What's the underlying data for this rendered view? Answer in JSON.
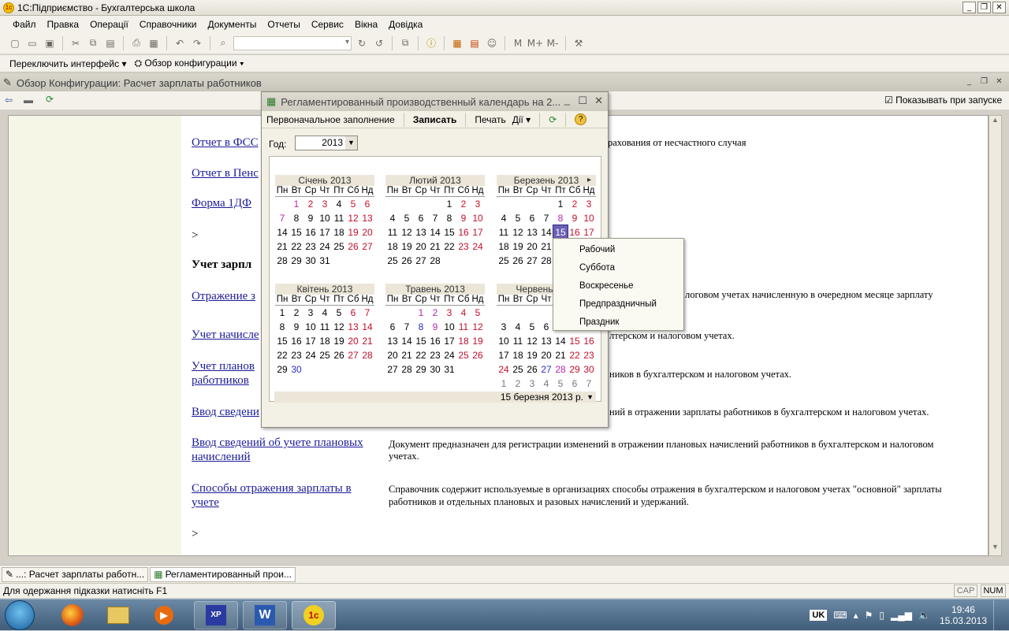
{
  "app": {
    "title": "1С:Підприємство - Бухгалтерська школа"
  },
  "menu": [
    "Файл",
    "Правка",
    "Операції",
    "Справочники",
    "Документы",
    "Отчеты",
    "Сервис",
    "Вікна",
    "Довідка"
  ],
  "toolbar2": {
    "switch_interface": "Переключить интерфейс",
    "overview": "Обзор конфигурации"
  },
  "overview": {
    "title": "Обзор Конфигурации: Расчет зарплаты работников",
    "show_on_start": "Показывать при запуске",
    "items": [
      {
        "link": "Отчет в ФСС",
        "desc": "рахования от несчастного случая"
      },
      {
        "link": "Отчет в Пенс",
        "desc": ""
      },
      {
        "link": "Форма 1ДФ",
        "desc": ""
      },
      {
        "link": ">",
        "desc": ""
      },
      {
        "link": "Учет зарпл",
        "desc": ""
      },
      {
        "link": "Отражение з",
        "desc": "логовом учетах начисленную в очередном месяце зарплату"
      },
      {
        "link": "Учет начисле",
        "desc": "лтерском и налоговом учетах."
      },
      {
        "link": "Учет планов",
        "link2": "работников",
        "desc": "ников в бухгалтерском и налоговом учетах."
      },
      {
        "link": "Ввод сведени",
        "desc": "ний в отражении зарплаты работников в бухгалтерском и налоговом учетах."
      },
      {
        "link": "Ввод сведений об учете плановых",
        "link2": "начислений",
        "desc": "Документ предназначен для регистрации изменений в отражении плановых начислений работников в бухгалтерском и налоговом",
        "desc2": "учетах."
      },
      {
        "link": "Способы отражения зарплаты в",
        "link2": "учете",
        "desc": "Справочник содержит используемые в организациях способы отражения в бухгалтерском и налоговом учетах \"основной\" зарплаты",
        "desc2": "работников и отдельных плановых и разовых начислений и удержаний."
      },
      {
        "link": ">",
        "desc": ""
      }
    ]
  },
  "dialog": {
    "title": "Регламентированный производственный календарь на 2...",
    "initial_fill": "Первоначальное заполнение",
    "save": "Записать",
    "print": "Печать",
    "actions": "Дії",
    "year_label": "Год:",
    "year": "2013",
    "footer_date": "15 березня 2013 р.",
    "weekdays": [
      "Пн",
      "Вт",
      "Ср",
      "Чт",
      "Пт",
      "Сб",
      "Нд"
    ],
    "months": [
      {
        "name": "Січень 2013",
        "offset": 1,
        "days": 31
      },
      {
        "name": "Лютий 2013",
        "offset": 4,
        "days": 28
      },
      {
        "name": "Березень 2013",
        "offset": 4,
        "days": 31
      },
      {
        "name": "Квітень 2013",
        "offset": 0,
        "days": 30
      },
      {
        "name": "Травень 2013",
        "offset": 2,
        "days": 31
      },
      {
        "name": "Червень 2013",
        "offset": 5,
        "days": 30
      }
    ]
  },
  "context_menu": [
    "Рабочий",
    "Суббота",
    "Воскресенье",
    "Предпраздничный",
    "Праздник"
  ],
  "tasks": [
    "...: Расчет зарплаты работн...",
    "Регламентированный прои..."
  ],
  "status": {
    "hint": "Для одержання підказки натисніть F1",
    "cap": "CAP",
    "num": "NUM"
  },
  "tray": {
    "lang": "UK",
    "time": "19:46",
    "date": "15.03.2013"
  }
}
